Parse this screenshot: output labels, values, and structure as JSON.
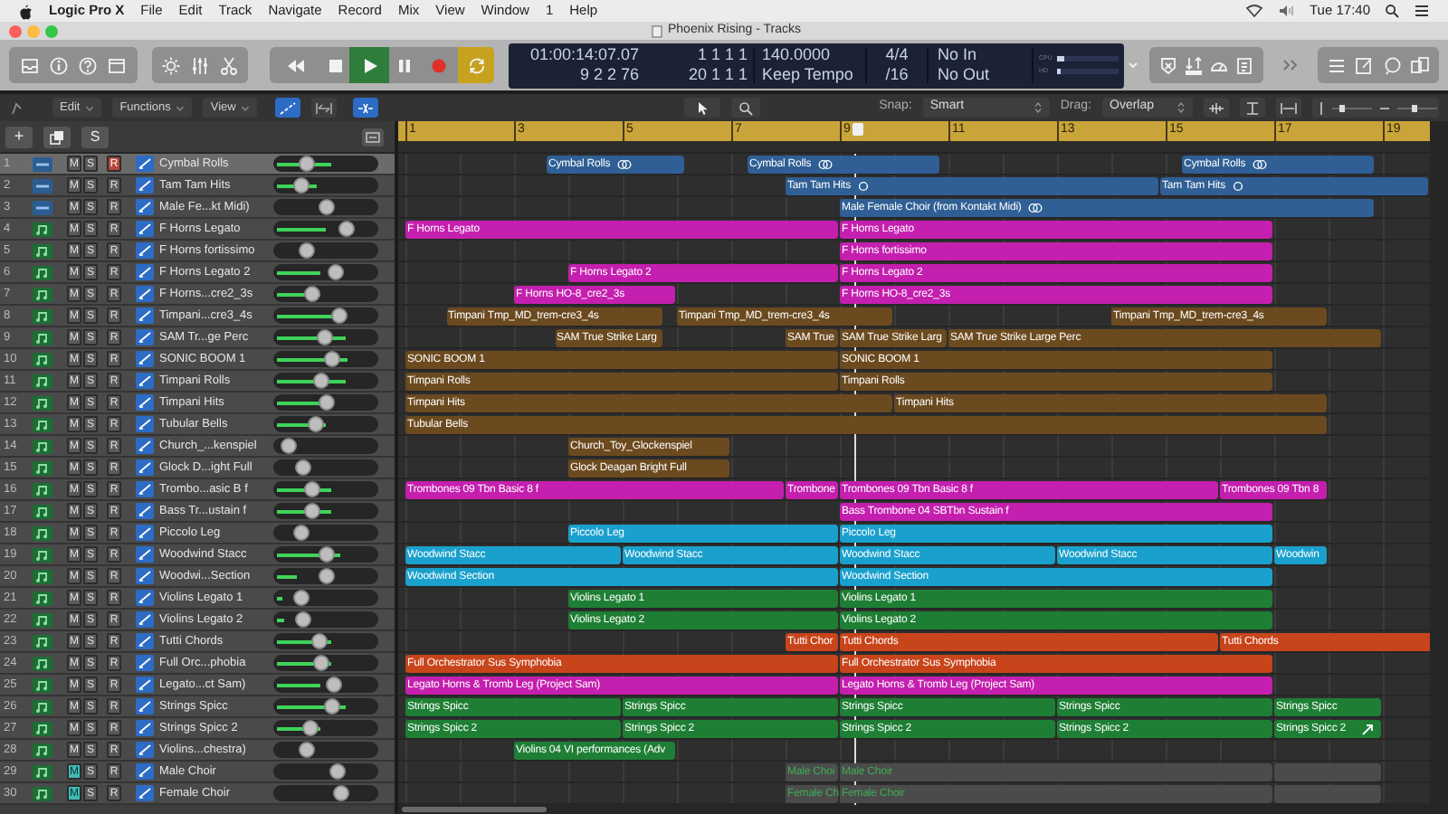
{
  "menubar": {
    "app": "Logic Pro X",
    "menus": [
      "File",
      "Edit",
      "Track",
      "Navigate",
      "Record",
      "Mix",
      "View",
      "Window",
      "1",
      "Help"
    ],
    "clock": "Tue 17:40"
  },
  "window": {
    "title": "Phoenix Rising - Tracks"
  },
  "transport": {
    "play": {
      "on": true
    },
    "cycle": {
      "on": true
    }
  },
  "lcd": {
    "time": "01:00:14:07.07",
    "bars": "9 2 2  76",
    "position": "1 1 1 1",
    "end_position": "20 1 1 1",
    "tempo": "140.0000",
    "tempo_mode": "Keep Tempo",
    "signature": "4/4",
    "division": "/16",
    "input": "No In",
    "output": "No Out",
    "meters": [
      {
        "label": "CPU",
        "level": 0.12
      },
      {
        "label": "HD",
        "level": 0.06
      }
    ]
  },
  "toolbar": {
    "menus": [
      "Edit",
      "Functions",
      "View"
    ],
    "snap_label": "Snap:",
    "snap": "Smart",
    "drag_label": "Drag:",
    "drag": "Overlap"
  },
  "list_header": {
    "add": "+",
    "solo": "S"
  },
  "ruler": {
    "marks": [
      "1",
      "3",
      "5",
      "7",
      "9",
      "11",
      "13",
      "15",
      "17",
      "19"
    ]
  },
  "tracks": [
    {
      "num": "1",
      "name": "Cymbal Rolls",
      "kind": "audio",
      "selected": true,
      "muted": false,
      "color": "#2f5f94",
      "buttons": [
        {
          "label": "M",
          "on": false
        },
        {
          "label": "S",
          "on": false
        },
        {
          "label": "R",
          "on": true
        }
      ],
      "volume": {
        "level": 0.29
      },
      "meter": {
        "level": 0.55
      },
      "regions": [
        {
          "label": "Cymbal Rolls",
          "kind": "loop"
        },
        {
          "label": "Cymbal Rolls",
          "kind": "loop"
        },
        {
          "label": "Cymbal Rolls",
          "kind": "loop"
        }
      ]
    },
    {
      "num": "2",
      "name": "Tam Tam Hits",
      "kind": "audio",
      "selected": false,
      "muted": false,
      "color": "#2f5f94",
      "buttons": [
        {
          "label": "M",
          "on": false
        },
        {
          "label": "S",
          "on": false
        },
        {
          "label": "R",
          "on": false
        }
      ],
      "volume": {
        "level": 0.23
      },
      "meter": {
        "level": 0.4
      },
      "regions": [
        {
          "label": "Tam Tam Hits",
          "kind": "circle"
        },
        {
          "label": "Tam Tam Hits",
          "kind": "circle"
        }
      ]
    },
    {
      "num": "3",
      "name": "Male Fe...kt Midi)",
      "kind": "audio",
      "selected": false,
      "muted": false,
      "color": "#2f5f94",
      "buttons": [
        {
          "label": "M",
          "on": false
        },
        {
          "label": "S",
          "on": false
        },
        {
          "label": "R",
          "on": false
        }
      ],
      "volume": {
        "level": 0.51
      },
      "regions": [
        {
          "label": "Male Female Choir (from Kontakt Midi)",
          "kind": "loop"
        }
      ]
    },
    {
      "num": "4",
      "name": "F Horns Legato",
      "kind": "instrument",
      "selected": false,
      "muted": false,
      "color": "#c41fae",
      "buttons": [
        {
          "label": "M",
          "on": false
        },
        {
          "label": "S",
          "on": false
        },
        {
          "label": "R",
          "on": false
        }
      ],
      "volume": {
        "level": 0.73
      },
      "meter": {
        "level": 0.5
      },
      "regions": [
        {
          "label": "F Horns Legato"
        },
        {
          "label": "F Horns Legato"
        }
      ]
    },
    {
      "num": "5",
      "name": "F Horns fortissimo",
      "kind": "instrument",
      "selected": false,
      "muted": false,
      "color": "#c41fae",
      "buttons": [
        {
          "label": "M",
          "on": false
        },
        {
          "label": "S",
          "on": false
        },
        {
          "label": "R",
          "on": false
        }
      ],
      "volume": {
        "level": 0.28
      },
      "regions": [
        {
          "label": "F Horns fortissimo"
        }
      ]
    },
    {
      "num": "6",
      "name": "F Horns Legato 2",
      "kind": "instrument",
      "selected": false,
      "muted": false,
      "color": "#c41fae",
      "buttons": [
        {
          "label": "M",
          "on": false
        },
        {
          "label": "S",
          "on": false
        },
        {
          "label": "R",
          "on": false
        }
      ],
      "volume": {
        "level": 0.62
      },
      "meter": {
        "level": 0.45
      },
      "regions": [
        {
          "label": "F Horns Legato 2"
        },
        {
          "label": "F Horns Legato 2"
        }
      ]
    },
    {
      "num": "7",
      "name": "F Horns...cre2_3s",
      "kind": "instrument",
      "selected": false,
      "muted": false,
      "color": "#c41fae",
      "buttons": [
        {
          "label": "M",
          "on": false
        },
        {
          "label": "S",
          "on": false
        },
        {
          "label": "R",
          "on": false
        }
      ],
      "volume": {
        "level": 0.34
      },
      "meter": {
        "level": 0.45
      },
      "regions": [
        {
          "label": "F Horns HO-8_cre2_3s"
        },
        {
          "label": "F Horns HO-8_cre2_3s"
        }
      ]
    },
    {
      "num": "8",
      "name": "Timpani...cre3_4s",
      "kind": "instrument",
      "selected": false,
      "muted": false,
      "color": "#6b4a1f",
      "buttons": [
        {
          "label": "M",
          "on": false
        },
        {
          "label": "S",
          "on": false
        },
        {
          "label": "R",
          "on": false
        }
      ],
      "volume": {
        "level": 0.65
      },
      "meter": {
        "level": 0.7
      },
      "regions": [
        {
          "label": "Timpani Tmp_MD_trem-cre3_4s"
        },
        {
          "label": "Timpani Tmp_MD_trem-cre3_4s"
        },
        {
          "label": "Timpani Tmp_MD_trem-cre3_4s"
        }
      ]
    },
    {
      "num": "9",
      "name": "SAM Tr...ge Perc",
      "kind": "instrument",
      "selected": false,
      "muted": false,
      "color": "#6b4a1f",
      "buttons": [
        {
          "label": "M",
          "on": false
        },
        {
          "label": "S",
          "on": false
        },
        {
          "label": "R",
          "on": false
        }
      ],
      "volume": {
        "level": 0.48
      },
      "meter": {
        "level": 0.7
      },
      "regions": [
        {
          "label": "SAM True Strike Larg"
        },
        {
          "label": "SAM True"
        },
        {
          "label": "SAM True Strike Larg"
        },
        {
          "label": "SAM True Strike Large Perc"
        }
      ]
    },
    {
      "num": "10",
      "name": "SONIC BOOM 1",
      "kind": "instrument",
      "selected": false,
      "muted": false,
      "color": "#6b4a1f",
      "buttons": [
        {
          "label": "M",
          "on": false
        },
        {
          "label": "S",
          "on": false
        },
        {
          "label": "R",
          "on": false
        }
      ],
      "volume": {
        "level": 0.57
      },
      "meter": {
        "level": 0.72
      },
      "regions": [
        {
          "label": "SONIC BOOM 1"
        },
        {
          "label": "SONIC BOOM 1"
        }
      ]
    },
    {
      "num": "11",
      "name": "Timpani Rolls",
      "kind": "instrument",
      "selected": false,
      "muted": false,
      "color": "#6b4a1f",
      "buttons": [
        {
          "label": "M",
          "on": false
        },
        {
          "label": "S",
          "on": false
        },
        {
          "label": "R",
          "on": false
        }
      ],
      "volume": {
        "level": 0.45
      },
      "meter": {
        "level": 0.7
      },
      "regions": [
        {
          "label": "Timpani Rolls"
        },
        {
          "label": "Timpani Rolls"
        }
      ]
    },
    {
      "num": "12",
      "name": "Timpani Hits",
      "kind": "instrument",
      "selected": false,
      "muted": false,
      "color": "#6b4a1f",
      "buttons": [
        {
          "label": "M",
          "on": false
        },
        {
          "label": "S",
          "on": false
        },
        {
          "label": "R",
          "on": false
        }
      ],
      "volume": {
        "level": 0.5
      },
      "meter": {
        "level": 0.45
      },
      "regions": [
        {
          "label": "Timpani Hits"
        },
        {
          "label": "Timpani Hits"
        }
      ]
    },
    {
      "num": "13",
      "name": "Tubular Bells",
      "kind": "instrument",
      "selected": false,
      "muted": false,
      "color": "#6b4a1f",
      "buttons": [
        {
          "label": "M",
          "on": false
        },
        {
          "label": "S",
          "on": false
        },
        {
          "label": "R",
          "on": false
        }
      ],
      "volume": {
        "level": 0.38
      },
      "meter": {
        "level": 0.5
      },
      "regions": [
        {
          "label": "Tubular Bells"
        }
      ]
    },
    {
      "num": "14",
      "name": "Church_...kenspiel",
      "kind": "instrument",
      "selected": false,
      "muted": false,
      "color": "#6b4a1f",
      "buttons": [
        {
          "label": "M",
          "on": false
        },
        {
          "label": "S",
          "on": false
        },
        {
          "label": "R",
          "on": false
        }
      ],
      "volume": {
        "level": 0.09
      },
      "regions": [
        {
          "label": "Church_Toy_Glockenspiel"
        }
      ]
    },
    {
      "num": "15",
      "name": "Glock D...ight Full",
      "kind": "instrument",
      "selected": false,
      "muted": false,
      "color": "#6b4a1f",
      "buttons": [
        {
          "label": "M",
          "on": false
        },
        {
          "label": "S",
          "on": false
        },
        {
          "label": "R",
          "on": false
        }
      ],
      "volume": {
        "level": 0.24
      },
      "regions": [
        {
          "label": "Glock Deagan Bright Full"
        }
      ]
    },
    {
      "num": "16",
      "name": "Trombo...asic B f",
      "kind": "instrument",
      "selected": false,
      "muted": false,
      "color": "#c41fae",
      "buttons": [
        {
          "label": "M",
          "on": false
        },
        {
          "label": "S",
          "on": false
        },
        {
          "label": "R",
          "on": false
        }
      ],
      "volume": {
        "level": 0.34
      },
      "meter": {
        "level": 0.55
      },
      "regions": [
        {
          "label": "Trombones 09 Tbn Basic 8 f"
        },
        {
          "label": "Trombone"
        },
        {
          "label": "Trombones 09 Tbn Basic 8 f"
        },
        {
          "label": "Trombones 09 Tbn 8"
        }
      ]
    },
    {
      "num": "17",
      "name": "Bass Tr...ustain f",
      "kind": "instrument",
      "selected": false,
      "muted": false,
      "color": "#c41fae",
      "buttons": [
        {
          "label": "M",
          "on": false
        },
        {
          "label": "S",
          "on": false
        },
        {
          "label": "R",
          "on": false
        }
      ],
      "volume": {
        "level": 0.34
      },
      "meter": {
        "level": 0.55
      },
      "regions": [
        {
          "label": "Bass Trombone 04 SBTbn Sustain f"
        }
      ]
    },
    {
      "num": "18",
      "name": "Piccolo Leg",
      "kind": "instrument",
      "selected": false,
      "muted": false,
      "color": "#1aa0cc",
      "buttons": [
        {
          "label": "M",
          "on": false
        },
        {
          "label": "S",
          "on": false
        },
        {
          "label": "R",
          "on": false
        }
      ],
      "volume": {
        "level": 0.23
      },
      "regions": [
        {
          "label": "Piccolo Leg"
        },
        {
          "label": "Piccolo Leg"
        }
      ]
    },
    {
      "num": "19",
      "name": "Woodwind Stacc",
      "kind": "instrument",
      "selected": false,
      "muted": false,
      "color": "#1aa0cc",
      "buttons": [
        {
          "label": "M",
          "on": false
        },
        {
          "label": "S",
          "on": false
        },
        {
          "label": "R",
          "on": false
        }
      ],
      "volume": {
        "level": 0.52
      },
      "meter": {
        "level": 0.65
      },
      "regions": [
        {
          "label": "Woodwind Stacc"
        },
        {
          "label": "Woodwind Stacc"
        },
        {
          "label": "Woodwind Stacc"
        },
        {
          "label": "Woodwind Stacc"
        },
        {
          "label": "Woodwin"
        }
      ]
    },
    {
      "num": "20",
      "name": "Woodwi...Section",
      "kind": "instrument",
      "selected": false,
      "muted": false,
      "color": "#1aa0cc",
      "buttons": [
        {
          "label": "M",
          "on": false
        },
        {
          "label": "S",
          "on": false
        },
        {
          "label": "R",
          "on": false
        }
      ],
      "volume": {
        "level": 0.51
      },
      "meter": {
        "level": 0.2
      },
      "regions": [
        {
          "label": "Woodwind Section"
        },
        {
          "label": "Woodwind Section"
        }
      ]
    },
    {
      "num": "21",
      "name": "Violins Legato 1",
      "kind": "instrument",
      "selected": false,
      "muted": false,
      "color": "#1e7f34",
      "buttons": [
        {
          "label": "M",
          "on": false
        },
        {
          "label": "S",
          "on": false
        },
        {
          "label": "R",
          "on": false
        }
      ],
      "volume": {
        "level": 0.23
      },
      "meter": {
        "level": 0.05
      },
      "regions": [
        {
          "label": "Violins Legato 1"
        },
        {
          "label": "Violins Legato 1"
        }
      ]
    },
    {
      "num": "22",
      "name": "Violins Legato 2",
      "kind": "instrument",
      "selected": false,
      "muted": false,
      "color": "#1e7f34",
      "buttons": [
        {
          "label": "M",
          "on": false
        },
        {
          "label": "S",
          "on": false
        },
        {
          "label": "R",
          "on": false
        }
      ],
      "volume": {
        "level": 0.25
      },
      "meter": {
        "level": 0.08
      },
      "regions": [
        {
          "label": "Violins Legato 2"
        },
        {
          "label": "Violins Legato 2"
        }
      ]
    },
    {
      "num": "23",
      "name": "Tutti Chords",
      "kind": "instrument",
      "selected": false,
      "muted": false,
      "color": "#c8441a",
      "buttons": [
        {
          "label": "M",
          "on": false
        },
        {
          "label": "S",
          "on": false
        },
        {
          "label": "R",
          "on": false
        }
      ],
      "volume": {
        "level": 0.42
      },
      "meter": {
        "level": 0.55
      },
      "regions": [
        {
          "label": "Tutti Chor"
        },
        {
          "label": "Tutti Chords"
        },
        {
          "label": "Tutti Chords"
        }
      ]
    },
    {
      "num": "24",
      "name": "Full Orc...phobia",
      "kind": "instrument",
      "selected": false,
      "muted": false,
      "color": "#c8441a",
      "buttons": [
        {
          "label": "M",
          "on": false
        },
        {
          "label": "S",
          "on": false
        },
        {
          "label": "R",
          "on": false
        }
      ],
      "volume": {
        "level": 0.45
      },
      "meter": {
        "level": 0.55
      },
      "regions": [
        {
          "label": "Full Orchestrator Sus Symphobia"
        },
        {
          "label": "Full Orchestrator Sus Symphobia"
        }
      ]
    },
    {
      "num": "25",
      "name": "Legato...ct Sam)",
      "kind": "instrument",
      "selected": false,
      "muted": false,
      "color": "#c41fae",
      "buttons": [
        {
          "label": "M",
          "on": false
        },
        {
          "label": "S",
          "on": false
        },
        {
          "label": "R",
          "on": false
        }
      ],
      "volume": {
        "level": 0.6
      },
      "meter": {
        "level": 0.45
      },
      "regions": [
        {
          "label": "Legato Horns & Tromb Leg (Project Sam)"
        },
        {
          "label": "Legato Horns & Tromb Leg (Project Sam)"
        }
      ]
    },
    {
      "num": "26",
      "name": "Strings Spicc",
      "kind": "instrument",
      "selected": false,
      "muted": false,
      "color": "#1e7f34",
      "buttons": [
        {
          "label": "M",
          "on": false
        },
        {
          "label": "S",
          "on": false
        },
        {
          "label": "R",
          "on": false
        }
      ],
      "volume": {
        "level": 0.58
      },
      "meter": {
        "level": 0.7
      },
      "regions": [
        {
          "label": "Strings Spicc"
        },
        {
          "label": "Strings Spicc"
        },
        {
          "label": "Strings Spicc"
        },
        {
          "label": "Strings Spicc"
        },
        {
          "label": "Strings Spicc"
        }
      ]
    },
    {
      "num": "27",
      "name": "Strings Spicc 2",
      "kind": "instrument",
      "selected": false,
      "muted": false,
      "color": "#1e7f34",
      "buttons": [
        {
          "label": "M",
          "on": false
        },
        {
          "label": "S",
          "on": false
        },
        {
          "label": "R",
          "on": false
        }
      ],
      "volume": {
        "level": 0.33
      },
      "meter": {
        "level": 0.45
      },
      "regions": [
        {
          "label": "Strings Spicc 2",
          "kind": "plain"
        },
        {
          "label": "Strings Spicc 2",
          "kind": "plain"
        },
        {
          "label": "Strings Spicc 2",
          "kind": "plain"
        },
        {
          "label": "Strings Spicc 2",
          "kind": "plain"
        },
        {
          "label": "Strings Spicc 2",
          "kind": "arrow"
        }
      ]
    },
    {
      "num": "28",
      "name": "Violins...chestra)",
      "kind": "instrument",
      "selected": false,
      "muted": false,
      "color": "#1e7f34",
      "buttons": [
        {
          "label": "M",
          "on": false
        },
        {
          "label": "S",
          "on": false
        },
        {
          "label": "R",
          "on": false
        }
      ],
      "volume": {
        "level": 0.29
      },
      "regions": [
        {
          "label": "Violins 04 VI performances (Adv"
        }
      ]
    },
    {
      "num": "29",
      "name": "Male Choir",
      "kind": "instrument",
      "selected": false,
      "muted": true,
      "color": "#3fae55",
      "buttons": [
        {
          "label": "M",
          "on": true
        },
        {
          "label": "S",
          "on": false
        },
        {
          "label": "R",
          "on": false
        }
      ],
      "volume": {
        "level": 0.63
      },
      "regions": [
        {
          "label": "Male Choi",
          "kind": "plain"
        },
        {
          "label": "Male Choir",
          "kind": "plain"
        },
        {
          "kind": "plain"
        }
      ]
    },
    {
      "num": "30",
      "name": "Female Choir",
      "kind": "instrument",
      "selected": false,
      "muted": true,
      "color": "#3fae55",
      "buttons": [
        {
          "label": "M",
          "on": true
        },
        {
          "label": "S",
          "on": false
        },
        {
          "label": "R",
          "on": false
        }
      ],
      "volume": {
        "level": 0.68
      },
      "regions": [
        {
          "label": "Female Ch",
          "kind": "plain"
        },
        {
          "label": "Female Choir",
          "kind": "plain"
        },
        {
          "kind": "plain"
        }
      ]
    }
  ]
}
